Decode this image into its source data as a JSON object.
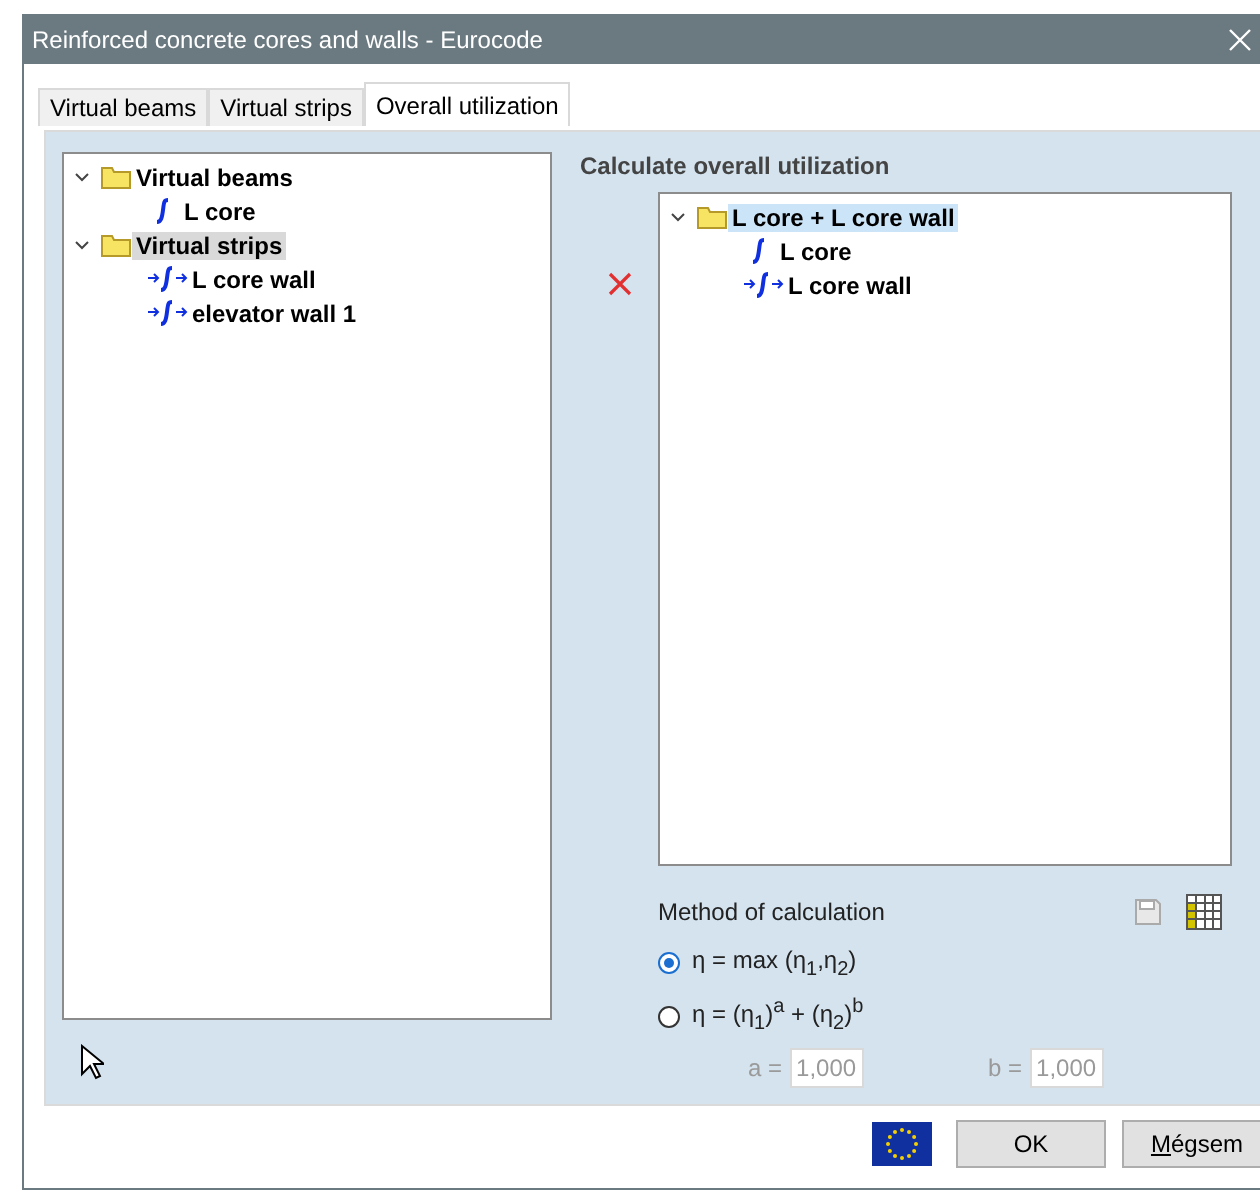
{
  "window": {
    "title": "Reinforced concrete cores and walls - Eurocode"
  },
  "tabs": [
    {
      "label": "Virtual beams",
      "selected": false
    },
    {
      "label": "Virtual strips",
      "selected": false
    },
    {
      "label": "Overall utilization",
      "selected": true
    }
  ],
  "source_tree": {
    "items": [
      {
        "label": "Virtual beams",
        "kind": "folder",
        "expanded": true,
        "selected": false,
        "children": [
          {
            "label": "L core",
            "kind": "beam",
            "selected": false
          }
        ]
      },
      {
        "label": "Virtual strips",
        "kind": "folder",
        "expanded": true,
        "selected": true,
        "children": [
          {
            "label": "L core wall",
            "kind": "strip",
            "selected": false
          },
          {
            "label": "elevator wall 1",
            "kind": "strip",
            "selected": false
          }
        ]
      }
    ]
  },
  "overall": {
    "heading": "Calculate overall utilization",
    "tree": {
      "items": [
        {
          "label": "L core + L core wall",
          "kind": "folder",
          "expanded": true,
          "selected": true,
          "children": [
            {
              "label": "L core",
              "kind": "beam",
              "selected": false
            },
            {
              "label": "L core wall",
              "kind": "strip",
              "selected": false
            }
          ]
        }
      ]
    }
  },
  "method": {
    "label": "Method of calculation",
    "options": [
      {
        "label": "η = max (η$_{1}$,η$_{2}$)",
        "selected": true
      },
      {
        "label": "η = (η$_{1}$)$^{a}$ + (η$_{2}$)$^{b}$",
        "selected": false
      }
    ],
    "fields": [
      {
        "label": "a =",
        "value": "1,000",
        "disabled": true
      },
      {
        "label": "b =",
        "value": "1,000",
        "disabled": true
      }
    ]
  },
  "buttons": [
    {
      "label": "OK"
    },
    {
      "label": "Mégsem"
    }
  ]
}
